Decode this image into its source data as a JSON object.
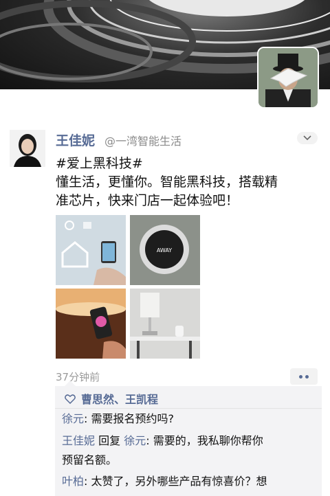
{
  "profile": {
    "cover_alt": "saturn-rings-cover",
    "avatar_alt": "man-with-bird-portrait"
  },
  "post": {
    "author": "王佳妮",
    "account": "@一湾智能生活",
    "lines": [
      "#爱上黑科技#",
      "懂生活，更懂你。智能黑科技，搭载精",
      "准芯片，快来门店一起体验吧！"
    ],
    "photos": [
      "smart-home-app-photo",
      "thermostat-photo",
      "smart-lamp-phone-photo",
      "smart-speaker-lamp-photo"
    ],
    "thermostat_display": "AWAY",
    "timestamp": "37分钟前"
  },
  "likes": {
    "names": "曹思然、王凯程"
  },
  "comments": [
    {
      "name": "徐元",
      "sep": ": ",
      "text": "需要报名预约吗?"
    },
    {
      "name": "王佳妮",
      "reply_word": " 回复 ",
      "reply_to": "徐元",
      "sep": ": ",
      "text": "需要的，我私聊你帮你",
      "text2": "预留名额。"
    },
    {
      "name": "叶柏",
      "sep": ": ",
      "text": "太赞了，另外哪些产品有惊喜价？想"
    }
  ],
  "colors": {
    "link": "#576b95",
    "panel": "#f3f3f5",
    "muted": "#9a9a9a"
  }
}
